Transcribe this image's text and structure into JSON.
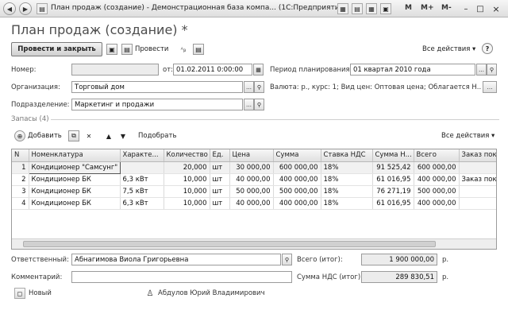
{
  "window": {
    "title": "План продаж (создание) - Демонстрационная база компа... (1С:Предприятие)",
    "m_label": "M",
    "m_plus": "M+",
    "m_minus": "M-"
  },
  "form": {
    "title": "План продаж (создание) *"
  },
  "toolbar": {
    "post_and_close": "Провести и закрыть",
    "post": "Провести",
    "all_actions": "Все действия ▾",
    "help": "?"
  },
  "fields": {
    "number_label": "Номер:",
    "number_value": "",
    "date_label": "от:",
    "date_value": "01.02.2011  0:00:00",
    "period_label": "Период планирования:",
    "period_value": "01 квартал 2010 года",
    "org_label": "Организация:",
    "org_value": "Торговый дом",
    "currency_text": "Валюта: р., курс: 1; Вид цен: Оптовая цена; Облагается Н...",
    "dept_label": "Подразделение:",
    "dept_value": "Маркетинг и продажи"
  },
  "stock": {
    "section_title": "Запасы (4)",
    "add": "Добавить",
    "select": "Подобрать",
    "all_actions": "Все действия ▾",
    "columns": [
      "N",
      "Номенклатура",
      "Характе...",
      "Количество",
      "Ед.",
      "Цена",
      "Сумма",
      "Ставка НДС",
      "Сумма Н...",
      "Всего",
      "Заказ пок"
    ],
    "rows": [
      [
        "1",
        "Кондиционер \"Самсунг\"",
        "",
        "20,000",
        "шт",
        "30 000,00",
        "600 000,00",
        "18%",
        "91 525,42",
        "600 000,00",
        ""
      ],
      [
        "2",
        "Кондиционер БК",
        "6,3 кВт",
        "10,000",
        "шт",
        "40 000,00",
        "400 000,00",
        "18%",
        "61 016,95",
        "400 000,00",
        "Заказ пок"
      ],
      [
        "3",
        "Кондиционер БК",
        "7,5 кВт",
        "10,000",
        "шт",
        "50 000,00",
        "500 000,00",
        "18%",
        "76 271,19",
        "500 000,00",
        ""
      ],
      [
        "4",
        "Кондиционер БК",
        "6,3 кВт",
        "10,000",
        "шт",
        "40 000,00",
        "400 000,00",
        "18%",
        "61 016,95",
        "400 000,00",
        ""
      ]
    ]
  },
  "footer": {
    "responsible_label": "Ответственный:",
    "responsible_value": "Абнагимова Виола Григорьевна",
    "total_label": "Всего (итог):",
    "total_value": "1 900 000,00",
    "total_unit": "р.",
    "comment_label": "Комментарий:",
    "comment_value": "",
    "vat_label": "Сумма НДС (итог):",
    "vat_value": "289 830,51",
    "vat_unit": "р.",
    "status_new": "Новый",
    "author": "Абдулов Юрий Владимирович"
  },
  "icons": {
    "back": "◀",
    "forward": "▶",
    "save": "▣",
    "post": "▤",
    "add": "⊕",
    "copy": "⧉",
    "delete": "✕",
    "up": "▲",
    "down": "▼",
    "select": "…",
    "calendar": "▦",
    "clear": "×",
    "search": "⚲",
    "minimize": "–",
    "maximize": "□",
    "close": "×",
    "new": "◻",
    "user": "♙"
  },
  "colors": {
    "titlebar": "#e6e6e6",
    "field_border": "#9b9b9b",
    "readonly_bg": "#ececec"
  }
}
